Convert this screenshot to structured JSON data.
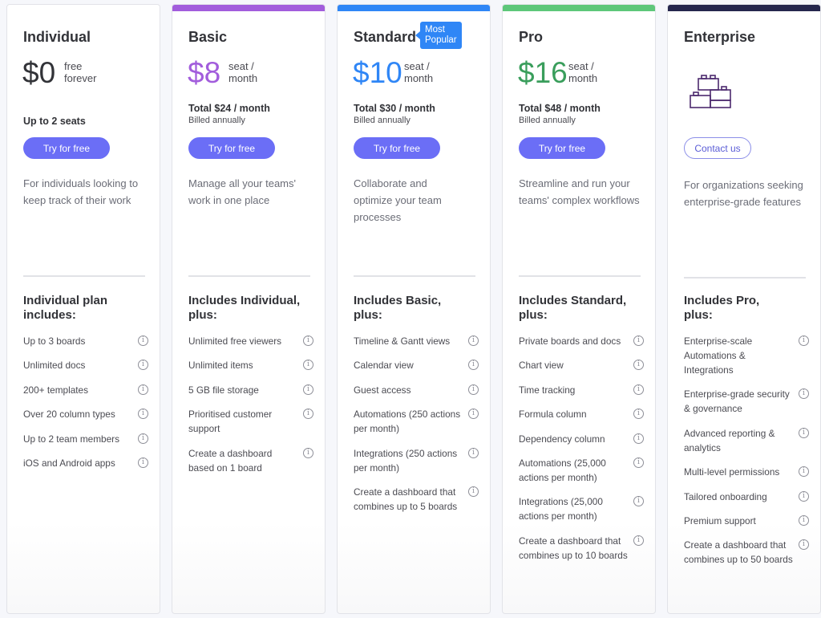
{
  "plans": [
    {
      "name": "Individual",
      "accent": "#323338",
      "topbar": null,
      "price": "$0",
      "price_unit": [
        "free",
        "forever"
      ],
      "seats": "Up to 2 seats",
      "cta": "Try for free",
      "description": "For individuals looking to keep track of their work",
      "features_title": "Individual plan includes:",
      "features": [
        "Up to 3 boards",
        "Unlimited docs",
        "200+ templates",
        "Over 20 column types",
        "Up to 2 team members",
        "iOS and Android apps"
      ]
    },
    {
      "name": "Basic",
      "accent": "#a25ddc",
      "topbar": "#a25ddc",
      "price": "$8",
      "price_unit": [
        "seat /",
        "month"
      ],
      "total": "Total $24 / month",
      "billed": "Billed annually",
      "cta": "Try for free",
      "description": "Manage all your teams' work in one place",
      "features_title": "Includes Individual, plus:",
      "features": [
        "Unlimited free viewers",
        "Unlimited items",
        "5 GB file storage",
        "Prioritised customer support",
        "Create a dashboard based on 1 board"
      ]
    },
    {
      "name": "Standard",
      "badge": [
        "Most",
        "Popular"
      ],
      "accent": "#2f86f6",
      "topbar": "#2f86f6",
      "price": "$10",
      "price_unit": [
        "seat /",
        "month"
      ],
      "total": "Total $30 / month",
      "billed": "Billed annually",
      "cta": "Try for free",
      "description": "Collaborate and optimize your team processes",
      "features_title": "Includes Basic, plus:",
      "features": [
        "Timeline & Gantt views",
        "Calendar view",
        "Guest access",
        "Automations (250 actions per month)",
        "Integrations (250 actions per month)",
        "Create a dashboard that combines up to 5 boards"
      ]
    },
    {
      "name": "Pro",
      "accent": "#3a9e5c",
      "topbar": "#5ec77a",
      "price": "$16",
      "price_unit": [
        "seat /",
        "month"
      ],
      "total": "Total $48 / month",
      "billed": "Billed annually",
      "cta": "Try for free",
      "description": "Streamline and run your teams' complex workflows",
      "features_title": "Includes Standard, plus:",
      "features": [
        "Private boards and docs",
        "Chart view",
        "Time tracking",
        "Formula column",
        "Dependency column",
        "Automations (25,000 actions per month)",
        "Integrations (25,000 actions per month)",
        "Create a dashboard that combines up to 10 boards"
      ]
    },
    {
      "name": "Enterprise",
      "accent": "#323338",
      "topbar": "#25264d",
      "icon": "building-blocks-icon",
      "cta": "Contact us",
      "description": "For organizations seeking enterprise-grade features",
      "features_title": "Includes Pro, plus:",
      "features": [
        "Enterprise-scale Automations & Integrations",
        "Enterprise-grade security & governance",
        "Advanced reporting & analytics",
        "Multi-level permissions",
        "Tailored onboarding",
        "Premium support",
        "Create a dashboard that combines up to 50 boards"
      ]
    }
  ],
  "info_icon_glyph": "i"
}
